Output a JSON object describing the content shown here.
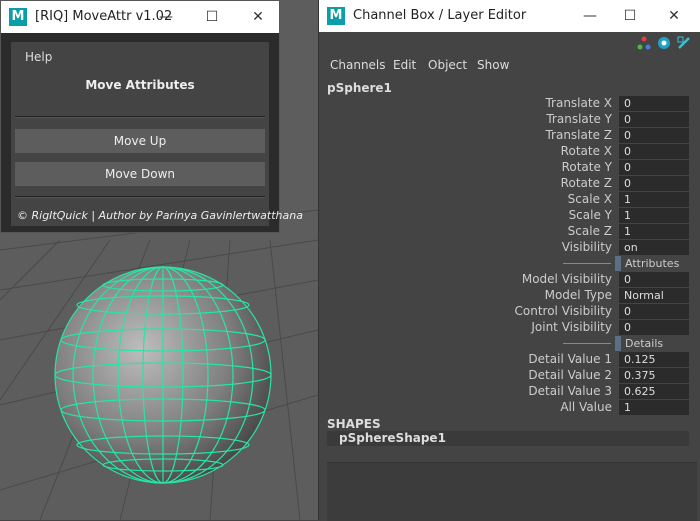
{
  "moveattr": {
    "title": "[RIQ] MoveAttr v1.02",
    "help_label": "Help",
    "heading": "Move Attributes",
    "move_up_label": "Move Up",
    "move_down_label": "Move Down",
    "footer": "© RigItQuick | Author by Parinya Gavinlertwatthana"
  },
  "channel_box": {
    "title": "Channel Box / Layer Editor",
    "menu": [
      "Channels",
      "Edit",
      "Object",
      "Show"
    ],
    "object_name": "pSphere1",
    "attributes": [
      {
        "label": "Translate X",
        "value": "0"
      },
      {
        "label": "Translate Y",
        "value": "0"
      },
      {
        "label": "Translate Z",
        "value": "0"
      },
      {
        "label": "Rotate X",
        "value": "0"
      },
      {
        "label": "Rotate Y",
        "value": "0"
      },
      {
        "label": "Rotate Z",
        "value": "0"
      },
      {
        "label": "Scale X",
        "value": "1"
      },
      {
        "label": "Scale Y",
        "value": "1"
      },
      {
        "label": "Scale Z",
        "value": "1"
      },
      {
        "label": "Visibility",
        "value": "on"
      },
      {
        "section": "Attributes"
      },
      {
        "label": "Model Visibility",
        "value": "0"
      },
      {
        "label": "Model Type",
        "value": "Normal"
      },
      {
        "label": "Control Visibility",
        "value": "0"
      },
      {
        "label": "Joint Visibility",
        "value": "0"
      },
      {
        "section": "Details"
      },
      {
        "label": "Detail Value 1",
        "value": "0.125"
      },
      {
        "label": "Detail Value 2",
        "value": "0.375"
      },
      {
        "label": "Detail Value 3",
        "value": "0.625"
      },
      {
        "label": "All Value",
        "value": "1"
      }
    ],
    "shapes_heading": "SHAPES",
    "shape_name": "pSphereShape1"
  },
  "icons": [
    "maya-logo-icon",
    "minimize-icon",
    "maximize-icon",
    "close-icon",
    "channel-box-toggle-icon",
    "attribute-editor-icon",
    "tool-settings-icon"
  ],
  "colors": {
    "wireframe": "#27e5a6",
    "section_bar": "#5b7082",
    "logo": "#0a9ea8"
  }
}
